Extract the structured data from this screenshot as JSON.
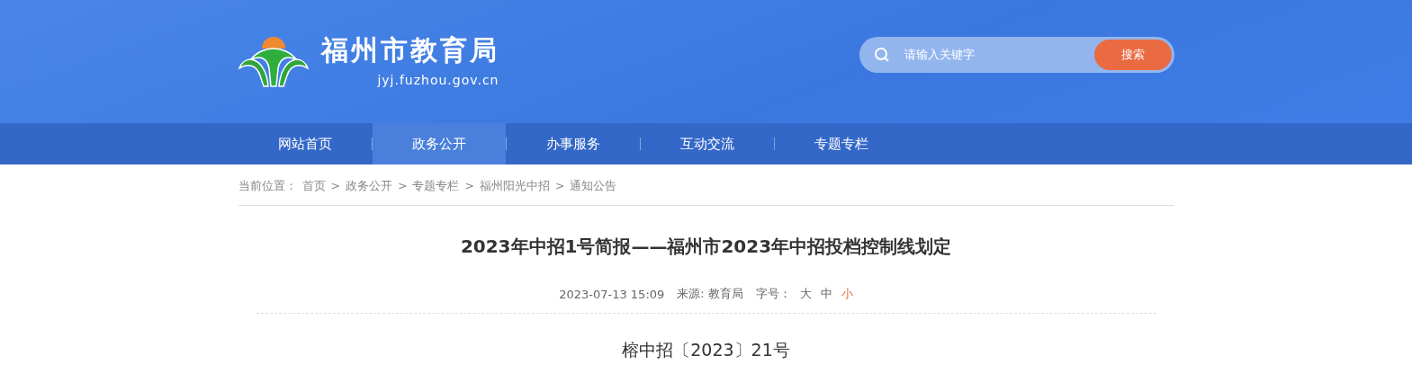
{
  "site": {
    "name": "福州市教育局",
    "url": "jyj.fuzhou.gov.cn"
  },
  "search": {
    "placeholder": "请输入关键字",
    "button": "搜索"
  },
  "nav": [
    {
      "label": "网站首页",
      "selected": false
    },
    {
      "label": "政务公开",
      "selected": true
    },
    {
      "label": "办事服务",
      "selected": false
    },
    {
      "label": "互动交流",
      "selected": false
    },
    {
      "label": "专题专栏",
      "selected": false
    }
  ],
  "breadcrumb": {
    "label": "当前位置：",
    "items": [
      "首页",
      "政务公开",
      "专题专栏",
      "福州阳光中招",
      "通知公告"
    ],
    "separator": ">"
  },
  "article": {
    "title": "2023年中招1号简报——福州市2023年中招投档控制线划定",
    "date": "2023-07-13 15:09",
    "source": "来源: 教育局",
    "font_label": "字号：",
    "font_sizes": [
      {
        "label": "大",
        "selected": false
      },
      {
        "label": "中",
        "selected": false
      },
      {
        "label": "小",
        "selected": true
      }
    ],
    "doc_number": "榕中招〔2023〕21号"
  }
}
